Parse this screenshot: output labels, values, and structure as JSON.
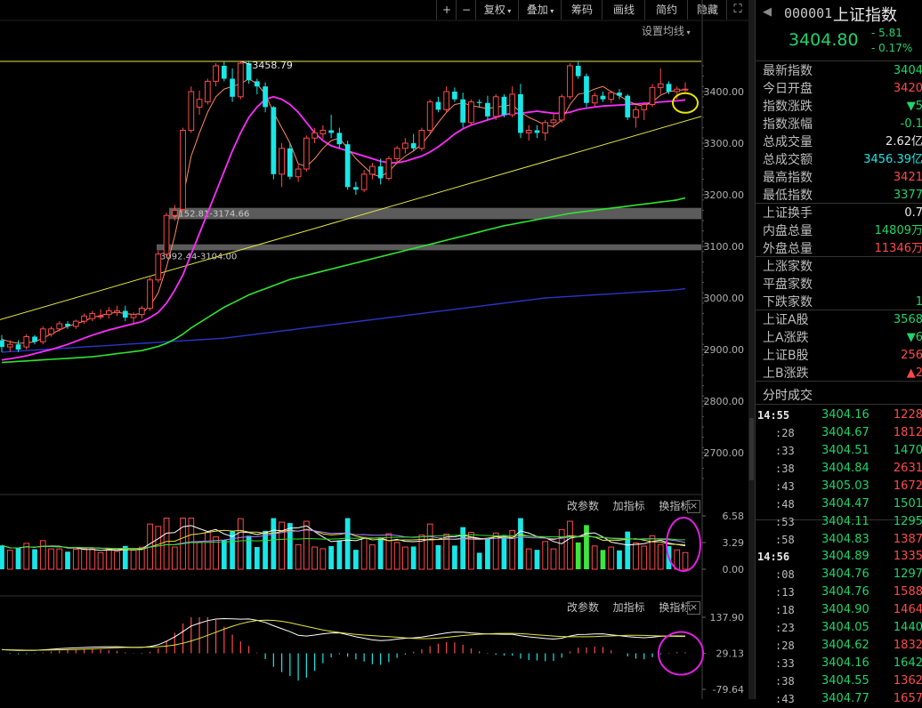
{
  "toolbar": {
    "plus": "+",
    "minus": "−",
    "restore_rights": "复权",
    "overlay": "叠加",
    "chips": "筹码",
    "draw": "画线",
    "simple": "简约",
    "hide": "隐藏",
    "ma_settings": "设置均线"
  },
  "panel_labels": {
    "change_params": "改参数",
    "add_indicator": "加指标",
    "switch_indicator": "换指标",
    "close": "×"
  },
  "annotations": {
    "high_label": "3458.79",
    "zone1": "3152.81-3174.66",
    "zone2": "3092.44-3104.00"
  },
  "colors": {
    "up": "#ff4a4a",
    "down": "#19e6e6",
    "ma5": "#ff8a60",
    "ma10": "#ff2cff",
    "ma20": "#2ee62e",
    "ma60": "#2a35c8",
    "trend": "#e6e640",
    "green": "#21d36b",
    "red": "#ff4a4a",
    "highlight_circle_yellow": "#e6e600",
    "highlight_circle_magenta": "#e020e0"
  },
  "chart_data": [
    {
      "type": "candlestick",
      "ylim": [
        2620,
        3480
      ],
      "yticks": [
        "3400.00",
        "3300.00",
        "3200.00",
        "3100.00",
        "3000.00",
        "2900.00",
        "2800.00",
        "2700.00"
      ],
      "ytick_values": [
        3400,
        3300,
        3200,
        3100,
        3000,
        2900,
        2800,
        2700
      ],
      "ohlc": [
        [
          2918,
          2928,
          2895,
          2905
        ],
        [
          2905,
          2918,
          2895,
          2910
        ],
        [
          2910,
          2918,
          2895,
          2900
        ],
        [
          2905,
          2930,
          2900,
          2925
        ],
        [
          2925,
          2928,
          2910,
          2915
        ],
        [
          2915,
          2945,
          2910,
          2940
        ],
        [
          2930,
          2945,
          2925,
          2940
        ],
        [
          2940,
          2955,
          2935,
          2950
        ],
        [
          2950,
          2955,
          2940,
          2945
        ],
        [
          2945,
          2958,
          2940,
          2955
        ],
        [
          2955,
          2970,
          2950,
          2965
        ],
        [
          2960,
          2975,
          2955,
          2970
        ],
        [
          2965,
          2978,
          2958,
          2965
        ],
        [
          2968,
          2982,
          2960,
          2975
        ],
        [
          2972,
          2985,
          2965,
          2975
        ],
        [
          2975,
          2985,
          2955,
          2962
        ],
        [
          2962,
          2972,
          2950,
          2968
        ],
        [
          2968,
          2985,
          2960,
          2980
        ],
        [
          2980,
          3040,
          2975,
          3035
        ],
        [
          3035,
          3092,
          3030,
          3085
        ],
        [
          3085,
          3165,
          3080,
          3160
        ],
        [
          3160,
          3180,
          3150,
          3170
        ],
        [
          3172,
          3330,
          3168,
          3325
        ],
        [
          3325,
          3410,
          3320,
          3400
        ],
        [
          3370,
          3402,
          3355,
          3385
        ],
        [
          3380,
          3425,
          3375,
          3420
        ],
        [
          3420,
          3455,
          3410,
          3450
        ],
        [
          3450,
          3458,
          3420,
          3425
        ],
        [
          3425,
          3445,
          3380,
          3390
        ],
        [
          3390,
          3458.79,
          3385,
          3455
        ],
        [
          3455,
          3460,
          3415,
          3422
        ],
        [
          3420,
          3425,
          3395,
          3410
        ],
        [
          3410,
          3418,
          3360,
          3370
        ],
        [
          3370,
          3372,
          3230,
          3240
        ],
        [
          3240,
          3300,
          3215,
          3290
        ],
        [
          3290,
          3300,
          3230,
          3235
        ],
        [
          3235,
          3258,
          3225,
          3250
        ],
        [
          3250,
          3315,
          3245,
          3310
        ],
        [
          3310,
          3330,
          3300,
          3320
        ],
        [
          3318,
          3335,
          3308,
          3325
        ],
        [
          3325,
          3355,
          3310,
          3320
        ],
        [
          3320,
          3330,
          3290,
          3298
        ],
        [
          3298,
          3305,
          3210,
          3215
        ],
        [
          3215,
          3225,
          3200,
          3210
        ],
        [
          3210,
          3248,
          3205,
          3240
        ],
        [
          3240,
          3262,
          3230,
          3255
        ],
        [
          3255,
          3270,
          3220,
          3232
        ],
        [
          3232,
          3275,
          3228,
          3270
        ],
        [
          3270,
          3295,
          3260,
          3290
        ],
        [
          3290,
          3310,
          3280,
          3300
        ],
        [
          3300,
          3318,
          3285,
          3290
        ],
        [
          3290,
          3330,
          3285,
          3325
        ],
        [
          3325,
          3385,
          3320,
          3380
        ],
        [
          3380,
          3390,
          3360,
          3365
        ],
        [
          3365,
          3410,
          3360,
          3400
        ],
        [
          3400,
          3408,
          3380,
          3385
        ],
        [
          3385,
          3398,
          3330,
          3340
        ],
        [
          3340,
          3385,
          3335,
          3380
        ],
        [
          3380,
          3385,
          3370,
          3378
        ],
        [
          3378,
          3392,
          3345,
          3352
        ],
        [
          3352,
          3395,
          3345,
          3390
        ],
        [
          3390,
          3395,
          3350,
          3355
        ],
        [
          3355,
          3410,
          3350,
          3395
        ],
        [
          3395,
          3415,
          3310,
          3320
        ],
        [
          3320,
          3335,
          3305,
          3325
        ],
        [
          3325,
          3335,
          3310,
          3320
        ],
        [
          3320,
          3345,
          3305,
          3340
        ],
        [
          3340,
          3360,
          3330,
          3345
        ],
        [
          3345,
          3395,
          3340,
          3390
        ],
        [
          3390,
          3455,
          3385,
          3450
        ],
        [
          3450,
          3460,
          3425,
          3430
        ],
        [
          3430,
          3435,
          3370,
          3378
        ],
        [
          3378,
          3398,
          3370,
          3392
        ],
        [
          3392,
          3400,
          3380,
          3385
        ],
        [
          3385,
          3402,
          3378,
          3398
        ],
        [
          3398,
          3405,
          3385,
          3392
        ],
        [
          3392,
          3395,
          3345,
          3350
        ],
        [
          3350,
          3372,
          3330,
          3365
        ],
        [
          3365,
          3380,
          3345,
          3375
        ],
        [
          3375,
          3415,
          3370,
          3408
        ],
        [
          3408,
          3445,
          3395,
          3415
        ],
        [
          3415,
          3420,
          3395,
          3400
        ],
        [
          3400,
          3410,
          3385,
          3404.8
        ],
        [
          3404.8,
          3418,
          3398,
          3404.8
        ]
      ],
      "ma5": [
        2920,
        2915,
        2912,
        2913,
        2915,
        2922,
        2930,
        2938,
        2945,
        2950,
        2955,
        2962,
        2966,
        2970,
        2972,
        2970,
        2968,
        2970,
        2985,
        3010,
        3060,
        3120,
        3195,
        3275,
        3320,
        3360,
        3390,
        3405,
        3410,
        3415,
        3425,
        3415,
        3395,
        3360,
        3330,
        3300,
        3260,
        3255,
        3270,
        3290,
        3305,
        3310,
        3290,
        3270,
        3255,
        3240,
        3235,
        3245,
        3262,
        3275,
        3285,
        3298,
        3318,
        3340,
        3360,
        3375,
        3378,
        3373,
        3370,
        3367,
        3370,
        3372,
        3375,
        3360,
        3350,
        3343,
        3335,
        3332,
        3345,
        3375,
        3395,
        3398,
        3405,
        3410,
        3400,
        3392,
        3382,
        3375,
        3372,
        3380,
        3393,
        3400,
        3402,
        3404
      ],
      "ma10": [
        2880,
        2882,
        2885,
        2888,
        2892,
        2896,
        2900,
        2905,
        2910,
        2916,
        2922,
        2928,
        2933,
        2938,
        2942,
        2946,
        2950,
        2954,
        2962,
        2972,
        2990,
        3015,
        3045,
        3085,
        3125,
        3165,
        3205,
        3245,
        3285,
        3320,
        3350,
        3370,
        3385,
        3390,
        3385,
        3375,
        3360,
        3340,
        3320,
        3305,
        3295,
        3290,
        3285,
        3280,
        3275,
        3270,
        3265,
        3262,
        3262,
        3265,
        3270,
        3275,
        3283,
        3293,
        3305,
        3318,
        3328,
        3335,
        3340,
        3345,
        3350,
        3355,
        3358,
        3358,
        3360,
        3362,
        3360,
        3358,
        3358,
        3360,
        3365,
        3368,
        3370,
        3372,
        3373,
        3374,
        3375,
        3376,
        3377,
        3378,
        3380,
        3381,
        3382,
        3384
      ],
      "ma20": [
        2875,
        2876,
        2877,
        2878,
        2879,
        2880,
        2881,
        2882,
        2883,
        2884,
        2885,
        2886,
        2888,
        2890,
        2892,
        2894,
        2896,
        2898,
        2902,
        2906,
        2912,
        2920,
        2930,
        2942,
        2952,
        2962,
        2972,
        2982,
        2990,
        2998,
        3006,
        3012,
        3018,
        3024,
        3030,
        3036,
        3040,
        3044,
        3048,
        3052,
        3056,
        3060,
        3064,
        3068,
        3072,
        3076,
        3080,
        3084,
        3088,
        3092,
        3096,
        3100,
        3104,
        3108,
        3112,
        3116,
        3120,
        3124,
        3128,
        3132,
        3136,
        3140,
        3143,
        3146,
        3149,
        3152,
        3155,
        3158,
        3161,
        3164,
        3166,
        3168,
        3170,
        3172,
        3174,
        3176,
        3178,
        3180,
        3182,
        3184,
        3186,
        3188,
        3190,
        3194
      ],
      "ma60": [
        2895,
        2896,
        2897,
        2898,
        2899,
        2900,
        2901,
        2902,
        2903,
        2904,
        2905,
        2906,
        2907,
        2908,
        2909,
        2910,
        2911,
        2912,
        2913,
        2914,
        2915,
        2916,
        2917,
        2918,
        2919,
        2920,
        2921,
        2922,
        2924,
        2926,
        2928,
        2930,
        2932,
        2934,
        2936,
        2938,
        2940,
        2942,
        2944,
        2946,
        2948,
        2950,
        2952,
        2954,
        2956,
        2958,
        2960,
        2962,
        2964,
        2966,
        2968,
        2970,
        2972,
        2974,
        2976,
        2978,
        2980,
        2982,
        2984,
        2986,
        2988,
        2990,
        2992,
        2994,
        2996,
        2998,
        3000,
        3001,
        3002,
        3003,
        3004,
        3005,
        3006,
        3007,
        3008,
        3009,
        3010,
        3011,
        3012,
        3013,
        3014,
        3015,
        3016,
        3018
      ]
    },
    {
      "type": "bar",
      "panel": "volume",
      "yticks": [
        "6.58",
        "3.29",
        "0.00"
      ],
      "ytick_values": [
        6.58,
        3.29,
        0
      ],
      "ylim": [
        0,
        6.58
      ]
    },
    {
      "type": "bar",
      "panel": "macd",
      "yticks": [
        "137.90",
        "29.13",
        "-79.64"
      ],
      "ytick_values": [
        137.9,
        29.13,
        -79.64
      ],
      "ylim": [
        -79.64,
        137.9
      ]
    }
  ],
  "quote": {
    "code": "000001",
    "name": "上证指数",
    "price": "3404.80",
    "change": "- 5.81",
    "change_pct": "- 0.17%",
    "rows": [
      {
        "label": "最新指数",
        "value": "3404",
        "color": "#21d36b"
      },
      {
        "label": "今日开盘",
        "value": "3420",
        "color": "#ff4a4a"
      },
      {
        "label": "指数涨跌",
        "value": "▼5",
        "color": "#21d36b"
      },
      {
        "label": "指数涨幅",
        "value": "-0.1",
        "color": "#21d36b"
      },
      {
        "label": "总成交量",
        "value": "2.62亿",
        "color": "#e8e8e8"
      },
      {
        "label": "总成交额",
        "value": "3456.39亿",
        "color": "#19e6e6"
      },
      {
        "label": "最高指数",
        "value": "3421",
        "color": "#ff4a4a"
      },
      {
        "label": "最低指数",
        "value": "3377",
        "color": "#21d36b"
      },
      {
        "label": "上证换手",
        "value": "0.7",
        "color": "#e8e8e8"
      },
      {
        "label": "内盘总量",
        "value": "14809万",
        "color": "#21d36b"
      },
      {
        "label": "外盘总量",
        "value": "11346万",
        "color": "#ff4a4a"
      },
      {
        "label": "上涨家数",
        "value": "",
        "color": "#ff4a4a"
      },
      {
        "label": "平盘家数",
        "value": "",
        "color": "#e8e8e8"
      },
      {
        "label": "下跌家数",
        "value": "1",
        "color": "#21d36b"
      },
      {
        "label": "上证A股",
        "value": "3568",
        "color": "#21d36b"
      },
      {
        "label": "上A涨跌",
        "value": "▼6",
        "color": "#21d36b"
      },
      {
        "label": "上证B股",
        "value": "256",
        "color": "#ff4a4a"
      },
      {
        "label": "上B涨跌",
        "value": "▲2",
        "color": "#ff4a4a"
      }
    ]
  },
  "ticks_header": "分时成交",
  "ticks": [
    {
      "time": "14:55",
      "price": "3404.16",
      "vol": "1228",
      "vcolor": "#ff4a4a",
      "bold": true
    },
    {
      "time": ":28",
      "price": "3404.67",
      "vol": "1812",
      "vcolor": "#ff4a4a"
    },
    {
      "time": ":33",
      "price": "3404.51",
      "vol": "1470",
      "vcolor": "#21d36b"
    },
    {
      "time": ":38",
      "price": "3404.84",
      "vol": "2631",
      "vcolor": "#ff4a4a"
    },
    {
      "time": ":43",
      "price": "3405.03",
      "vol": "1672",
      "vcolor": "#ff4a4a"
    },
    {
      "time": ":48",
      "price": "3404.47",
      "vol": "1501",
      "vcolor": "#21d36b"
    },
    {
      "time": ":53",
      "price": "3404.11",
      "vol": "1295",
      "vcolor": "#21d36b"
    },
    {
      "time": ":58",
      "price": "3404.83",
      "vol": "1387",
      "vcolor": "#ff4a4a"
    },
    {
      "time": "14:56",
      "price": "3404.89",
      "vol": "1335",
      "vcolor": "#ff4a4a",
      "bold": true
    },
    {
      "time": ":08",
      "price": "3404.76",
      "vol": "1297",
      "vcolor": "#21d36b"
    },
    {
      "time": ":13",
      "price": "3404.76",
      "vol": "1588",
      "vcolor": "#ff4a4a"
    },
    {
      "time": ":18",
      "price": "3404.90",
      "vol": "1464",
      "vcolor": "#ff4a4a"
    },
    {
      "time": ":23",
      "price": "3404.05",
      "vol": "1440",
      "vcolor": "#21d36b"
    },
    {
      "time": ":28",
      "price": "3404.62",
      "vol": "1832",
      "vcolor": "#ff4a4a"
    },
    {
      "time": ":33",
      "price": "3404.16",
      "vol": "1642",
      "vcolor": "#21d36b"
    },
    {
      "time": ":38",
      "price": "3404.55",
      "vol": "1362",
      "vcolor": "#ff4a4a"
    },
    {
      "time": ":43",
      "price": "3404.77",
      "vol": "1657",
      "vcolor": "#ff4a4a"
    }
  ]
}
